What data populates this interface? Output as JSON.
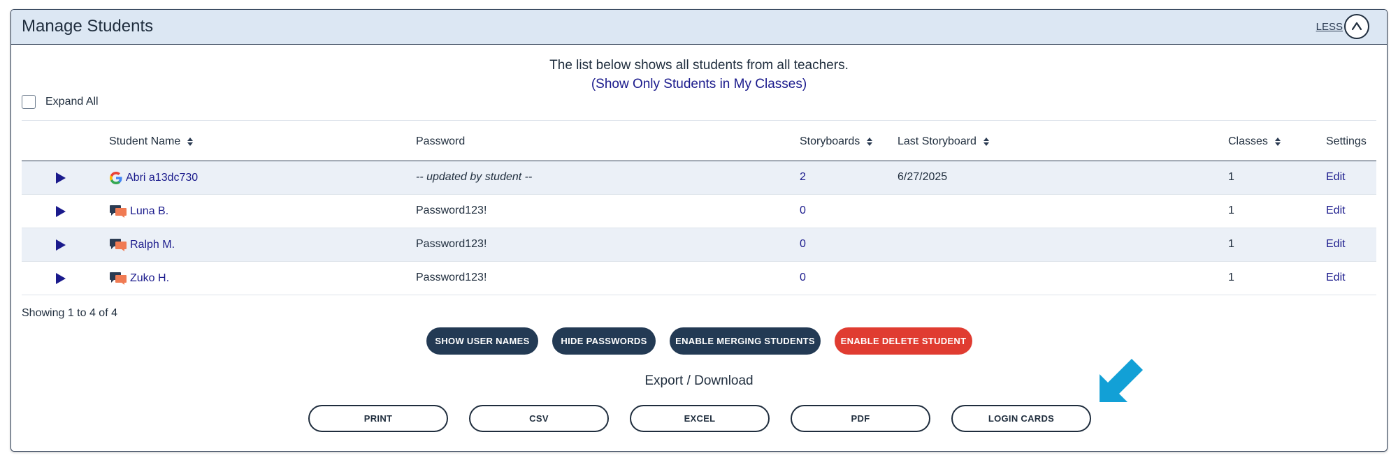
{
  "header": {
    "title": "Manage Students",
    "less_label": "LESS"
  },
  "intro": {
    "line1": "The list below shows all students from all teachers.",
    "link": "(Show Only Students in My Classes)"
  },
  "expand_all": {
    "label": "Expand All",
    "checked": false
  },
  "table": {
    "columns": {
      "name": "Student Name",
      "password": "Password",
      "storyboards": "Storyboards",
      "last_storyboard": "Last Storyboard",
      "classes": "Classes",
      "settings": "Settings"
    },
    "rows": [
      {
        "account_icon": "google-icon",
        "name": "Abri a13dc730",
        "password": "-- updated by student --",
        "storyboards": "2",
        "last_storyboard": "6/27/2025",
        "classes": "1",
        "settings": "Edit"
      },
      {
        "account_icon": "chat-bubbles-icon",
        "name": "Luna B.",
        "password": "Password123!",
        "storyboards": "0",
        "last_storyboard": "",
        "classes": "1",
        "settings": "Edit"
      },
      {
        "account_icon": "chat-bubbles-icon",
        "name": "Ralph M.",
        "password": "Password123!",
        "storyboards": "0",
        "last_storyboard": "",
        "classes": "1",
        "settings": "Edit"
      },
      {
        "account_icon": "chat-bubbles-icon",
        "name": "Zuko H.",
        "password": "Password123!",
        "storyboards": "0",
        "last_storyboard": "",
        "classes": "1",
        "settings": "Edit"
      }
    ]
  },
  "showing": "Showing 1 to 4 of 4",
  "actions": {
    "show_user_names": "SHOW USER NAMES",
    "hide_passwords": "HIDE PASSWORDS",
    "enable_merging": "ENABLE MERGING STUDENTS",
    "enable_delete": "ENABLE DELETE STUDENT"
  },
  "export": {
    "title": "Export / Download",
    "print": "PRINT",
    "csv": "CSV",
    "excel": "EXCEL",
    "pdf": "PDF",
    "login_cards": "LOGIN CARDS"
  },
  "colors": {
    "header_bg": "#dce7f3",
    "navy": "#233a54",
    "red": "#e03c31",
    "link": "#1a1a8c",
    "arrow": "#12a0d6",
    "row_alt": "#ebf0f7"
  }
}
